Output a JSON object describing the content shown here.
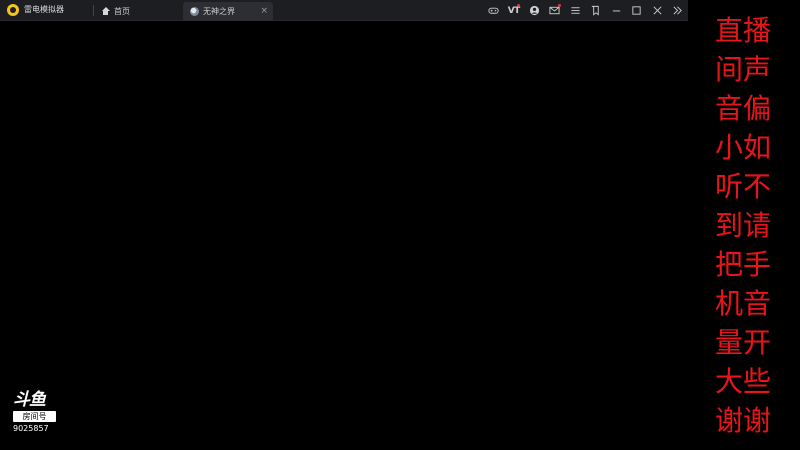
{
  "app": {
    "name": "雷电模拟器",
    "logo_color": "#f5c518"
  },
  "tabs": [
    {
      "label": "首页",
      "icon": "home-icon",
      "active": false
    },
    {
      "label": "无神之界",
      "icon": "game-icon",
      "active": true,
      "close": "×"
    }
  ],
  "toolbar": {
    "gamepad_icon": "gamepad-icon",
    "vt_label": "VT",
    "account_icon": "account-icon",
    "mail_icon": "mail-icon",
    "menu_icon": "menu-icon",
    "edit_icon": "edit-icon",
    "minimize_icon": "minimize-icon",
    "maximize_icon": "maximize-icon",
    "close_icon": "close-icon",
    "expand_icon": "expand-icon"
  },
  "watermark": {
    "logo_text": "斗鱼",
    "room_label": "房间号",
    "room_id": "9025857"
  },
  "notice": {
    "color": "#e8141b",
    "lines": [
      "直播",
      "间声",
      "音偏",
      "小如",
      "听不",
      "到请",
      "把手",
      "机音",
      "量开",
      "大些",
      "谢谢"
    ]
  }
}
